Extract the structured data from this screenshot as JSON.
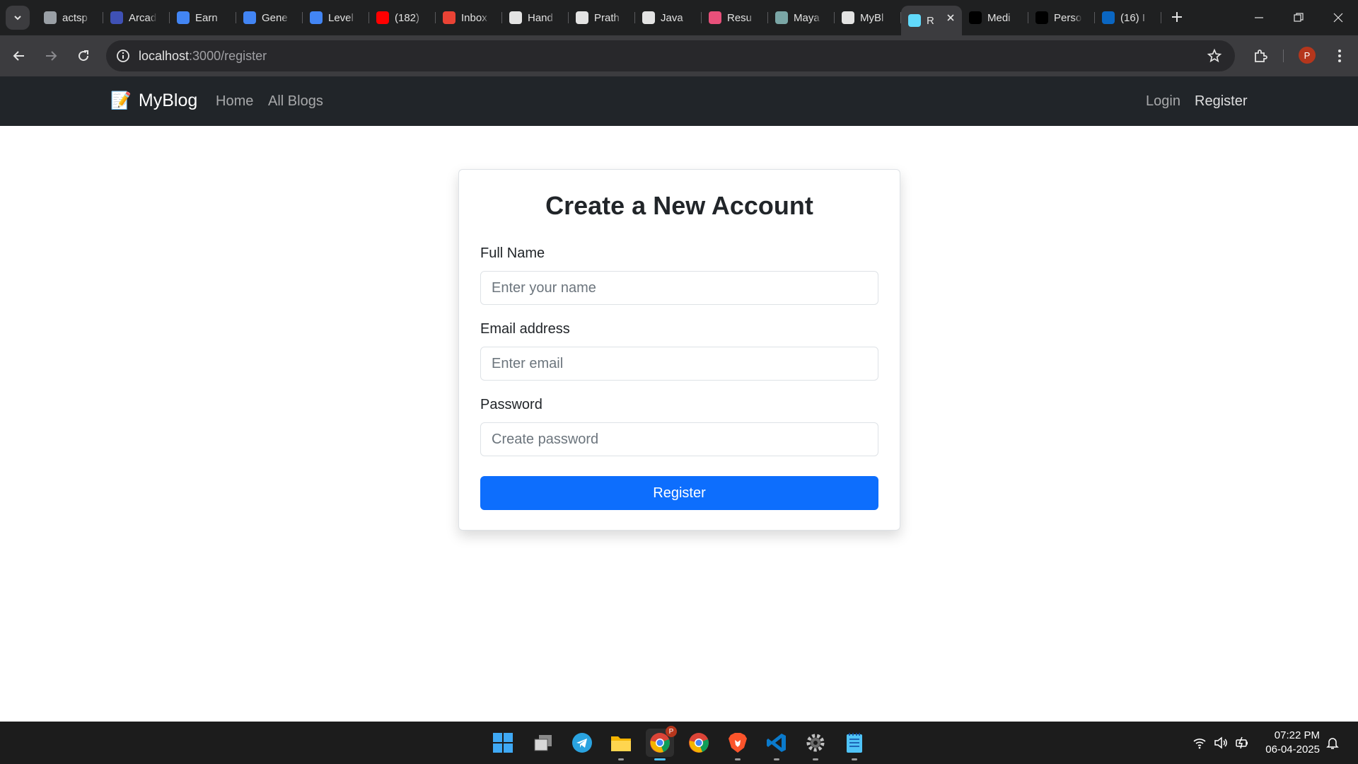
{
  "browser": {
    "tabs": [
      {
        "title": "actsp",
        "icon": "actsp-icon",
        "color": "#9aa0a6"
      },
      {
        "title": "Arcad",
        "icon": "arcade-icon",
        "color": "#3f51b5"
      },
      {
        "title": "Earn",
        "icon": "google-cloud-icon",
        "color": "#4285f4"
      },
      {
        "title": "Gene",
        "icon": "google-cloud-icon",
        "color": "#4285f4"
      },
      {
        "title": "Level",
        "icon": "google-cloud-icon",
        "color": "#4285f4"
      },
      {
        "title": "(182)",
        "icon": "youtube-icon",
        "color": "#ff0000"
      },
      {
        "title": "Inbox",
        "icon": "gmail-icon",
        "color": "#ea4335"
      },
      {
        "title": "Hand",
        "icon": "chatgpt-icon",
        "color": "#e3e3e3"
      },
      {
        "title": "Prath",
        "icon": "github-icon",
        "color": "#e3e3e3"
      },
      {
        "title": "Java",
        "icon": "chatgpt-icon",
        "color": "#e3e3e3"
      },
      {
        "title": "Resu",
        "icon": "resume-icon",
        "color": "#e8507a"
      },
      {
        "title": "Maya",
        "icon": "avatar-icon",
        "color": "#7aa6a6"
      },
      {
        "title": "MyBl",
        "icon": "chatgpt-icon",
        "color": "#e3e3e3"
      },
      {
        "title": "R",
        "icon": "react-icon",
        "color": "#61dafb",
        "active": true
      },
      {
        "title": "Medi",
        "icon": "medium-icon",
        "color": "#000000"
      },
      {
        "title": "Perso",
        "icon": "portfolio-icon",
        "color": "#000000"
      },
      {
        "title": "(16) I",
        "icon": "linkedin-icon",
        "color": "#0a66c2"
      }
    ],
    "url_host": "localhost",
    "url_path": ":3000/register",
    "profile_initial": "P"
  },
  "site": {
    "brand_emoji": "📝",
    "brand": "MyBlog",
    "nav": {
      "home": "Home",
      "all_blogs": "All Blogs",
      "login": "Login",
      "register": "Register"
    }
  },
  "form": {
    "title": "Create a New Account",
    "name_label": "Full Name",
    "name_placeholder": "Enter your name",
    "email_label": "Email address",
    "email_placeholder": "Enter email",
    "password_label": "Password",
    "password_placeholder": "Create password",
    "submit_label": "Register"
  },
  "taskbar": {
    "apps": [
      "windows-start-icon",
      "task-view-icon",
      "telegram-icon",
      "file-explorer-icon",
      "chrome-profile-icon",
      "chrome-icon",
      "brave-icon",
      "vscode-icon",
      "settings-icon",
      "notepad-icon"
    ],
    "chrome_badge": "P",
    "time": "07:22 PM",
    "date": "06-04-2025"
  },
  "colors": {
    "primary": "#0d6efd",
    "navbar": "#212529",
    "chrome_frame": "#1f2021"
  }
}
